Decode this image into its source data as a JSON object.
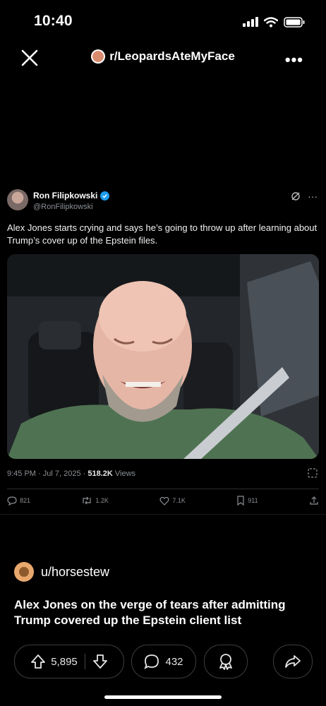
{
  "status_bar": {
    "time": "10:40"
  },
  "nav": {
    "subreddit": "r/LeopardsAteMyFace",
    "more": "•••"
  },
  "tweet": {
    "name": "Ron Filipkowski",
    "handle": "@RonFilipkowski",
    "text": "Alex Jones starts crying and says he’s going to throw up after learning about Trump’s cover up of the Epstein files.",
    "timestamp": "9:45 PM · Jul 7, 2025 · ",
    "views_count": "518.2K",
    "views_label": " Views",
    "stats": {
      "replies": "821",
      "reposts": "1.2K",
      "likes": "7.1K",
      "bookmarks": "911"
    }
  },
  "post": {
    "username": "u/horsestew",
    "title": "Alex Jones on the verge of tears after admitting Trump covered up the Epstein client list",
    "upvotes": "5,895",
    "comments": "432"
  }
}
